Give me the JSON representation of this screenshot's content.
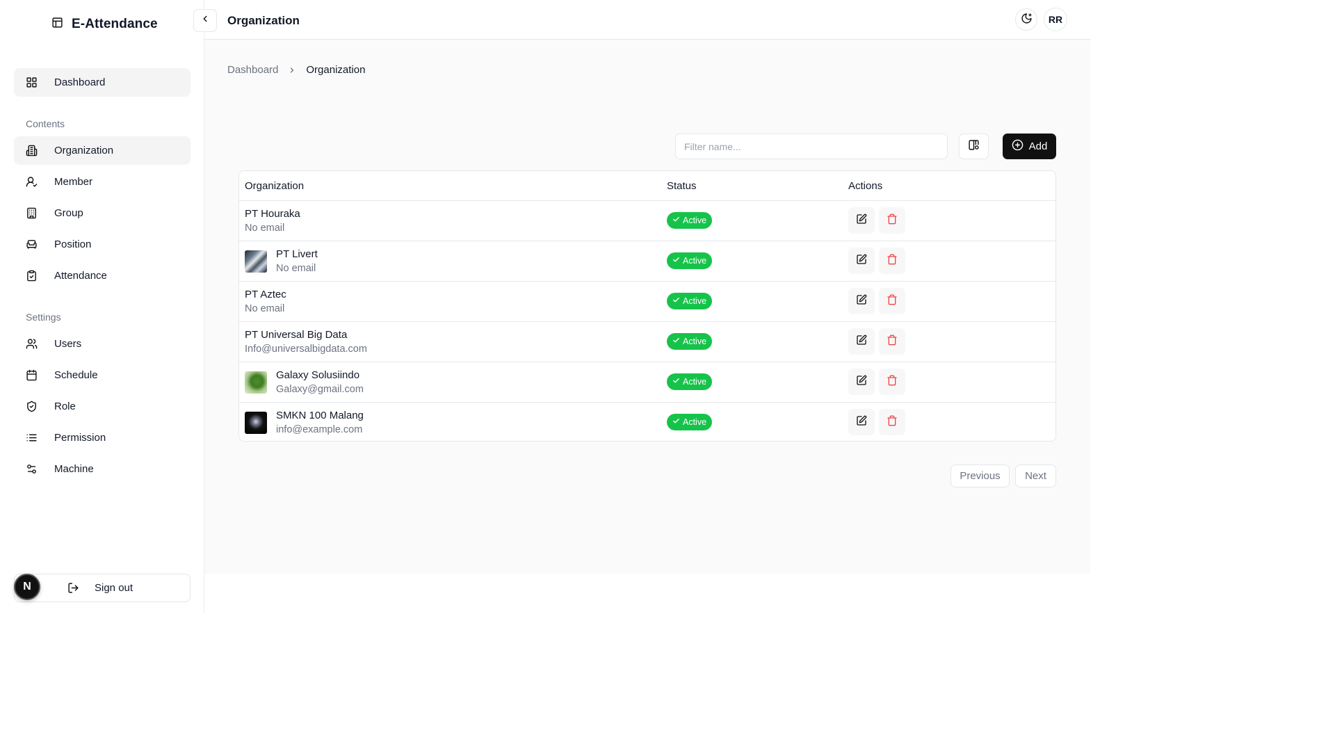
{
  "app": {
    "brand_title": "E-Attendance"
  },
  "sidebar": {
    "dashboard_label": "Dashboard",
    "contents_label": "Contents",
    "contents_items": [
      {
        "label": "Organization",
        "icon": "building-icon",
        "active": true
      },
      {
        "label": "Member",
        "icon": "user-check-icon"
      },
      {
        "label": "Group",
        "icon": "building-grid-icon"
      },
      {
        "label": "Position",
        "icon": "armchair-icon"
      },
      {
        "label": "Attendance",
        "icon": "clipboard-check-icon"
      }
    ],
    "settings_label": "Settings",
    "settings_items": [
      {
        "label": "Users",
        "icon": "users-icon"
      },
      {
        "label": "Schedule",
        "icon": "calendar-icon"
      },
      {
        "label": "Role",
        "icon": "shield-check-icon"
      },
      {
        "label": "Permission",
        "icon": "list-icon"
      },
      {
        "label": "Machine",
        "icon": "sliders-icon"
      }
    ],
    "signout_label": "Sign out",
    "n_badge": "N"
  },
  "header": {
    "title": "Organization",
    "avatar_initials": "RR"
  },
  "breadcrumb": {
    "parent": "Dashboard",
    "current": "Organization"
  },
  "toolbar": {
    "filter_placeholder": "Filter name...",
    "add_label": "Add"
  },
  "table": {
    "columns": [
      "Organization",
      "Status",
      "Actions"
    ],
    "rows": [
      {
        "name": "PT Houraka",
        "email": "No email",
        "status": "Active",
        "avatar": null
      },
      {
        "name": "PT Livert",
        "email": "No email",
        "status": "Active",
        "avatar": "waterfall"
      },
      {
        "name": "PT Aztec",
        "email": "No email",
        "status": "Active",
        "avatar": null
      },
      {
        "name": "PT Universal Big Data",
        "email": "Info@universalbigdata.com",
        "status": "Active",
        "avatar": null
      },
      {
        "name": "Galaxy Solusiindo",
        "email": "Galaxy@gmail.com",
        "status": "Active",
        "avatar": "green-creature"
      },
      {
        "name": "SMKN 100 Malang",
        "email": "info@example.com",
        "status": "Active",
        "avatar": "dark-figure"
      }
    ]
  },
  "pagination": {
    "previous_label": "Previous",
    "next_label": "Next"
  },
  "colors": {
    "active_badge": "#16c34a",
    "delete_icon": "#ef4444",
    "primary_button": "#111111"
  }
}
